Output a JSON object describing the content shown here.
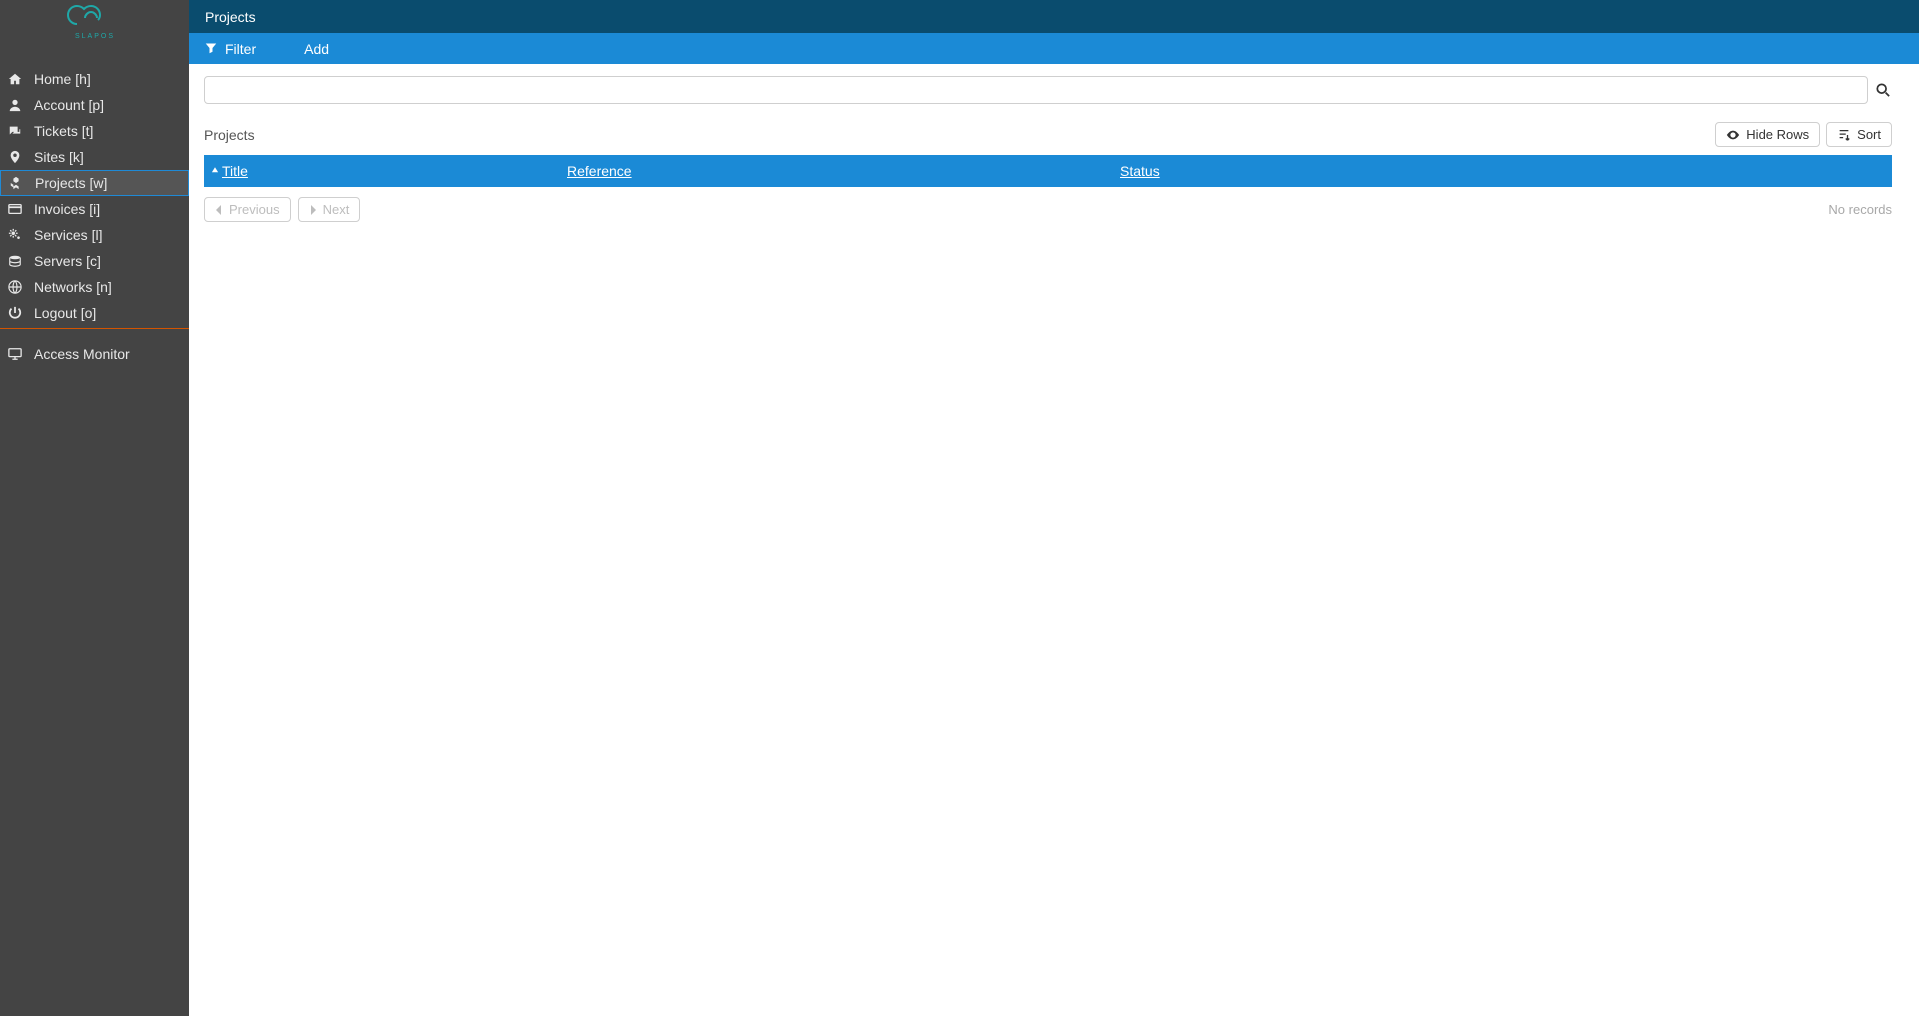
{
  "brand": {
    "name": "SLAPOS"
  },
  "sidebar": {
    "items": [
      {
        "label": "Home [h]",
        "icon": "home-icon",
        "active": false
      },
      {
        "label": "Account [p]",
        "icon": "user-icon",
        "active": false
      },
      {
        "label": "Tickets [t]",
        "icon": "comments-icon",
        "active": false
      },
      {
        "label": "Sites [k]",
        "icon": "map-marker-icon",
        "active": false
      },
      {
        "label": "Projects [w]",
        "icon": "cubes-icon",
        "active": true
      },
      {
        "label": "Invoices [i]",
        "icon": "credit-card-icon",
        "active": false
      },
      {
        "label": "Services [l]",
        "icon": "cogs-icon",
        "active": false
      },
      {
        "label": "Servers [c]",
        "icon": "server-icon",
        "active": false
      },
      {
        "label": "Networks [n]",
        "icon": "globe-icon",
        "active": false
      },
      {
        "label": "Logout [o]",
        "icon": "power-icon",
        "active": false
      }
    ],
    "secondary": [
      {
        "label": "Access Monitor",
        "icon": "desktop-icon"
      }
    ]
  },
  "header": {
    "title": "Projects"
  },
  "subheader": {
    "filter_label": "Filter",
    "add_label": "Add"
  },
  "toolbar": {
    "section_label": "Projects",
    "hide_rows_label": "Hide Rows",
    "sort_label": "Sort"
  },
  "table": {
    "columns": [
      {
        "key": "title",
        "label": "Title",
        "sorted": "asc"
      },
      {
        "key": "reference",
        "label": "Reference"
      },
      {
        "key": "status",
        "label": "Status"
      }
    ],
    "rows": []
  },
  "pager": {
    "previous_label": "Previous",
    "next_label": "Next",
    "no_records_label": "No records"
  },
  "search": {
    "placeholder": ""
  }
}
